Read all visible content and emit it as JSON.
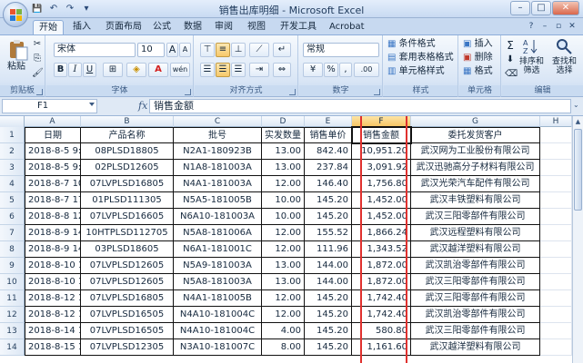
{
  "window": {
    "title": "销售出库明细 - Microsoft Excel",
    "controls": {
      "minimize": "–",
      "maximize": "□",
      "close": "✕"
    }
  },
  "qat": {
    "save": "💾",
    "undo": "↶",
    "redo": "↷",
    "more": "▾"
  },
  "tabs": [
    "开始",
    "插入",
    "页面布局",
    "公式",
    "数据",
    "审阅",
    "视图",
    "开发工具",
    "Acrobat"
  ],
  "tab_right": {
    "help": "?",
    "min": "–",
    "restore": "▫",
    "close": "✕"
  },
  "ribbon": {
    "clipboard": {
      "paste": "粘贴",
      "label": "剪贴板"
    },
    "font": {
      "name": "宋体",
      "size": "10",
      "bold": "B",
      "italic": "I",
      "underline": "U",
      "grow": "A",
      "shrink": "A",
      "label": "字体",
      "color_a": "A",
      "phonetic": "wén"
    },
    "alignment": {
      "label": "对齐方式"
    },
    "number": {
      "format": "常规",
      "percent": "%",
      "comma": ",",
      "label": "数字",
      "currency": "¥",
      "inc_dec": ".00"
    },
    "styles": {
      "conditional": "条件格式",
      "table": "套用表格格式",
      "cell": "单元格样式",
      "label": "样式"
    },
    "cells": {
      "insert": "插入",
      "delete": "删除",
      "format": "格式",
      "label": "单元格"
    },
    "editing": {
      "sum": "Σ",
      "sort": "排序和\n筛选",
      "find": "查找和\n选择",
      "label": "编辑"
    }
  },
  "formula_bar": {
    "name_box": "F1",
    "fx": "fx",
    "content": "销售金额"
  },
  "columns": [
    "A",
    "B",
    "C",
    "D",
    "E",
    "F",
    "G",
    "H"
  ],
  "headers": [
    "日期",
    "产品名称",
    "批号",
    "实发数量",
    "销售单价",
    "销售金额",
    "委托发货客户"
  ],
  "rows": [
    [
      "2018-8-5 9:30",
      "08PLSD18805",
      "N2A1-180923B",
      "13.00",
      "842.40",
      "10,951.20",
      "武汉网为工业股份有限公司"
    ],
    [
      "2018-8-5 9:31",
      "02PLSD12605",
      "N1A8-181003A",
      "13.00",
      "237.84",
      "3,091.92",
      "武汉迅驰高分子材料有限公司"
    ],
    [
      "2018-8-7 10:28",
      "07LVPLSD16805",
      "N4A1-181003A",
      "12.00",
      "146.40",
      "1,756.80",
      "武汉光荣汽车配件有限公司"
    ],
    [
      "2018-8-7 17:20",
      "01PLSD111305",
      "N5A5-181005B",
      "10.00",
      "145.20",
      "1,452.00",
      "武汉丰铁塑料有限公司"
    ],
    [
      "2018-8-8 12:36",
      "07LVPLSD16605",
      "N6A10-181003A",
      "10.00",
      "145.20",
      "1,452.00",
      "武汉三阳零部件有限公司"
    ],
    [
      "2018-8-9 14:21",
      "10HTPLSD112705",
      "N5A8-181006A",
      "12.00",
      "155.52",
      "1,866.24",
      "武汉远程塑料有限公司"
    ],
    [
      "2018-8-9 14:28",
      "03PLSD18605",
      "N6A1-181001C",
      "12.00",
      "111.96",
      "1,343.52",
      "武汉越洋塑料有限公司"
    ],
    [
      "2018-8-10 15:32",
      "07LVPLSD12605",
      "N5A9-181003A",
      "13.00",
      "144.00",
      "1,872.00",
      "武汉凯治零部件有限公司"
    ],
    [
      "2018-8-10 16:24",
      "07LVPLSD12605",
      "N5A8-181003A",
      "13.00",
      "144.00",
      "1,872.00",
      "武汉三阳零部件有限公司"
    ],
    [
      "2018-8-12 11:40",
      "07LVPLSD16805",
      "N4A1-181005B",
      "12.00",
      "145.20",
      "1,742.40",
      "武汉三阳零部件有限公司"
    ],
    [
      "2018-8-12 12:35",
      "07LVPLSD16505",
      "N4A10-181004C",
      "12.00",
      "145.20",
      "1,742.40",
      "武汉凯治零部件有限公司"
    ],
    [
      "2018-8-14 13:53",
      "07LVPLSD16505",
      "N4A10-181004C",
      "4.00",
      "145.20",
      "580.80",
      "武汉三阳零部件有限公司"
    ],
    [
      "2018-8-15 16:42",
      "07LVPLSD12305",
      "N3A10-181007C",
      "8.00",
      "145.20",
      "1,161.60",
      "武汉越洋塑料有限公司"
    ]
  ],
  "row_numbers": [
    "1",
    "2",
    "3",
    "4",
    "5",
    "6",
    "7",
    "8",
    "9",
    "10",
    "11",
    "12",
    "13",
    "14"
  ],
  "colors": {
    "selection_outline": "#e0312e",
    "ribbon_blue": "#c7d9f0"
  }
}
